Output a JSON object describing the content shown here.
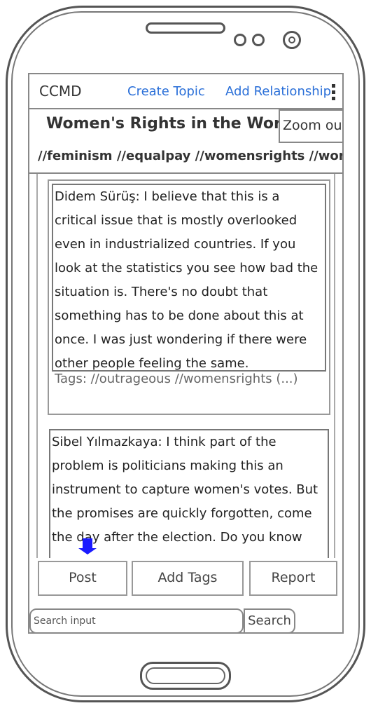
{
  "header": {
    "app_name": "CCMD",
    "create_topic": "Create Topic",
    "add_relationship": "Add Relationship"
  },
  "topic": {
    "title": "Women's Rights in the Workplace",
    "zoom_out": "Zoom out",
    "tags": "//feminism //equalpay //womensrights //work"
  },
  "posts": [
    {
      "text": "Didem Sürüş: I believe that this is a critical issue that is mostly overlooked even in industrialized countries. If you look at the statistics you see how bad the situation is. There's no doubt that something has to be done about this at once. I was just wondering if there were other people feeling the same.",
      "tags": "Tags: //outrageous //womensrights (...)"
    },
    {
      "text": "Sibel Yılmazkaya: I think part of the problem is politicians making this an instrument to capture women's votes. But the promises are quickly forgotten, come the day after the election. Do you know any"
    }
  ],
  "actions": {
    "post": "Post",
    "add_tags": "Add Tags",
    "report": "Report"
  },
  "search": {
    "placeholder": "Search input",
    "button": "Search"
  },
  "colors": {
    "link": "#2a6fd8",
    "scroll_arrow": "#1a1aff"
  },
  "icons": [
    "overflow-menu-icon",
    "scroll-down-arrow-icon"
  ]
}
